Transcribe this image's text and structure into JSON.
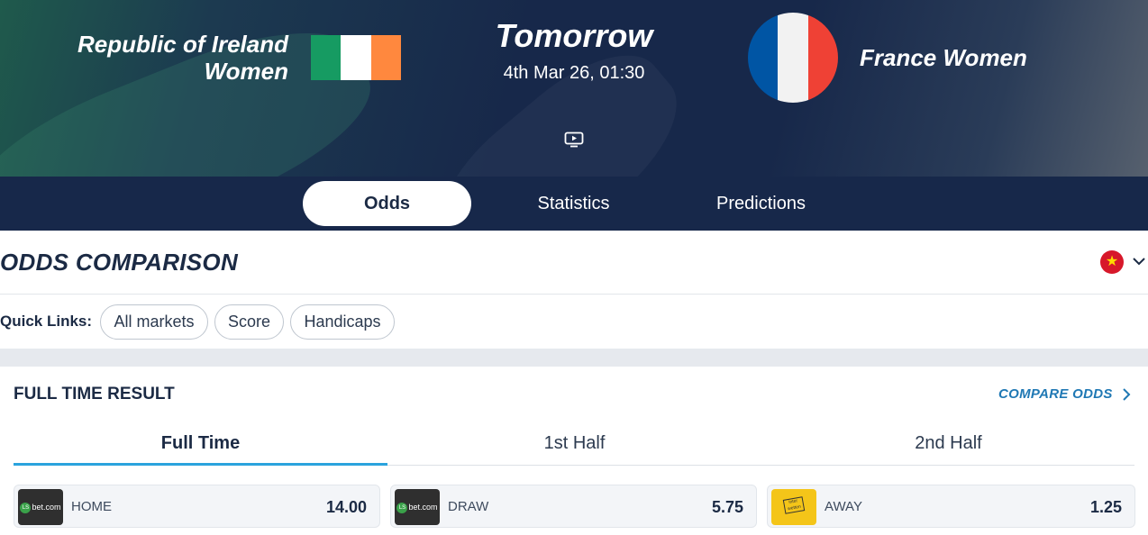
{
  "match": {
    "home_team": "Republic of Ireland Women",
    "home_team_line1": "Republic of Ireland",
    "home_team_line2": "Women",
    "away_team": "France Women",
    "when": "Tomorrow",
    "datetime": "4th Mar 26, 01:30",
    "home_flag_colors": [
      "#169b62",
      "#ffffff",
      "#ff883e"
    ],
    "away_flag_colors": [
      "#0055a4",
      "#f2f2f2",
      "#ef4135"
    ],
    "media_icon": "tv-play-icon"
  },
  "tabs": [
    {
      "label": "Odds",
      "active": true
    },
    {
      "label": "Statistics",
      "active": false
    },
    {
      "label": "Predictions",
      "active": false
    }
  ],
  "odds_comparison": {
    "title": "ODDS COMPARISON",
    "region_flag": "vietnam-flag-icon",
    "region_star": "★"
  },
  "quick_links": {
    "label": "Quick Links:",
    "items": [
      "All markets",
      "Score",
      "Handicaps"
    ]
  },
  "full_time_result": {
    "title": "FULL TIME RESULT",
    "compare_label": "COMPARE ODDS",
    "periods": [
      {
        "label": "Full Time",
        "active": true
      },
      {
        "label": "1st Half",
        "active": false
      },
      {
        "label": "2nd Half",
        "active": false
      }
    ],
    "odds": [
      {
        "bookmaker": "LSbet",
        "logo_text": "bet.com",
        "logo_badge": "LS",
        "label": "HOME",
        "value": "14.00"
      },
      {
        "bookmaker": "LSbet",
        "logo_text": "bet.com",
        "logo_badge": "LS",
        "label": "DRAW",
        "value": "5.75"
      },
      {
        "bookmaker": "Interwetten",
        "logo_text": "inter wetten",
        "label": "AWAY",
        "value": "1.25"
      }
    ]
  },
  "colors": {
    "navy": "#17284a",
    "accent_blue": "#2aa3dd",
    "link_blue": "#1f78b4"
  }
}
